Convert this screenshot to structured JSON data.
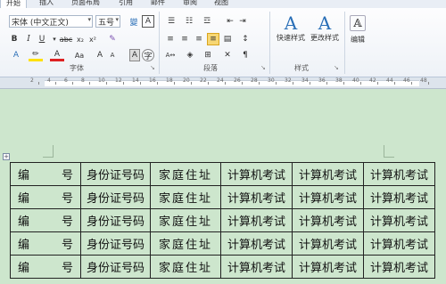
{
  "ribbon_tabs": [
    "开始",
    "插入",
    "页面布局",
    "引用",
    "邮件",
    "审阅",
    "视图"
  ],
  "font": {
    "name": "宋体 (中文正文)",
    "size": "五号",
    "group_label": "字体"
  },
  "paragraph": {
    "group_label": "段落"
  },
  "styles": {
    "quick_label": "快速样式",
    "change_label": "更改样式",
    "group_label": "样式"
  },
  "editing": {
    "label": "编辑"
  },
  "ruler_numbers": [
    "2",
    "4",
    "6",
    "8",
    "10",
    "12",
    "14",
    "16",
    "18",
    "20",
    "22",
    "24",
    "26",
    "28",
    "30",
    "32",
    "34",
    "36",
    "38",
    "40",
    "42",
    "44",
    "46",
    "48"
  ],
  "table": {
    "rows": [
      [
        "编",
        "号",
        "身份证号码",
        "家庭住址",
        "计算机考试",
        "计算机考试",
        "计算机考试"
      ],
      [
        "编",
        "号",
        "身份证号码",
        "家庭住址",
        "计算机考试",
        "计算机考试",
        "计算机考试"
      ],
      [
        "编",
        "号",
        "身份证号码",
        "家庭住址",
        "计算机考试",
        "计算机考试",
        "计算机考试"
      ],
      [
        "编",
        "号",
        "身份证号码",
        "家庭住址",
        "计算机考试",
        "计算机考试",
        "计算机考试"
      ],
      [
        "编",
        "号",
        "身份证号码",
        "家庭住址",
        "计算机考试",
        "计算机考试",
        "计算机考试"
      ]
    ]
  },
  "colors": {
    "page_background": "#cde6cd",
    "accent": "#2a6fb7",
    "highlight": "#f7d774"
  }
}
